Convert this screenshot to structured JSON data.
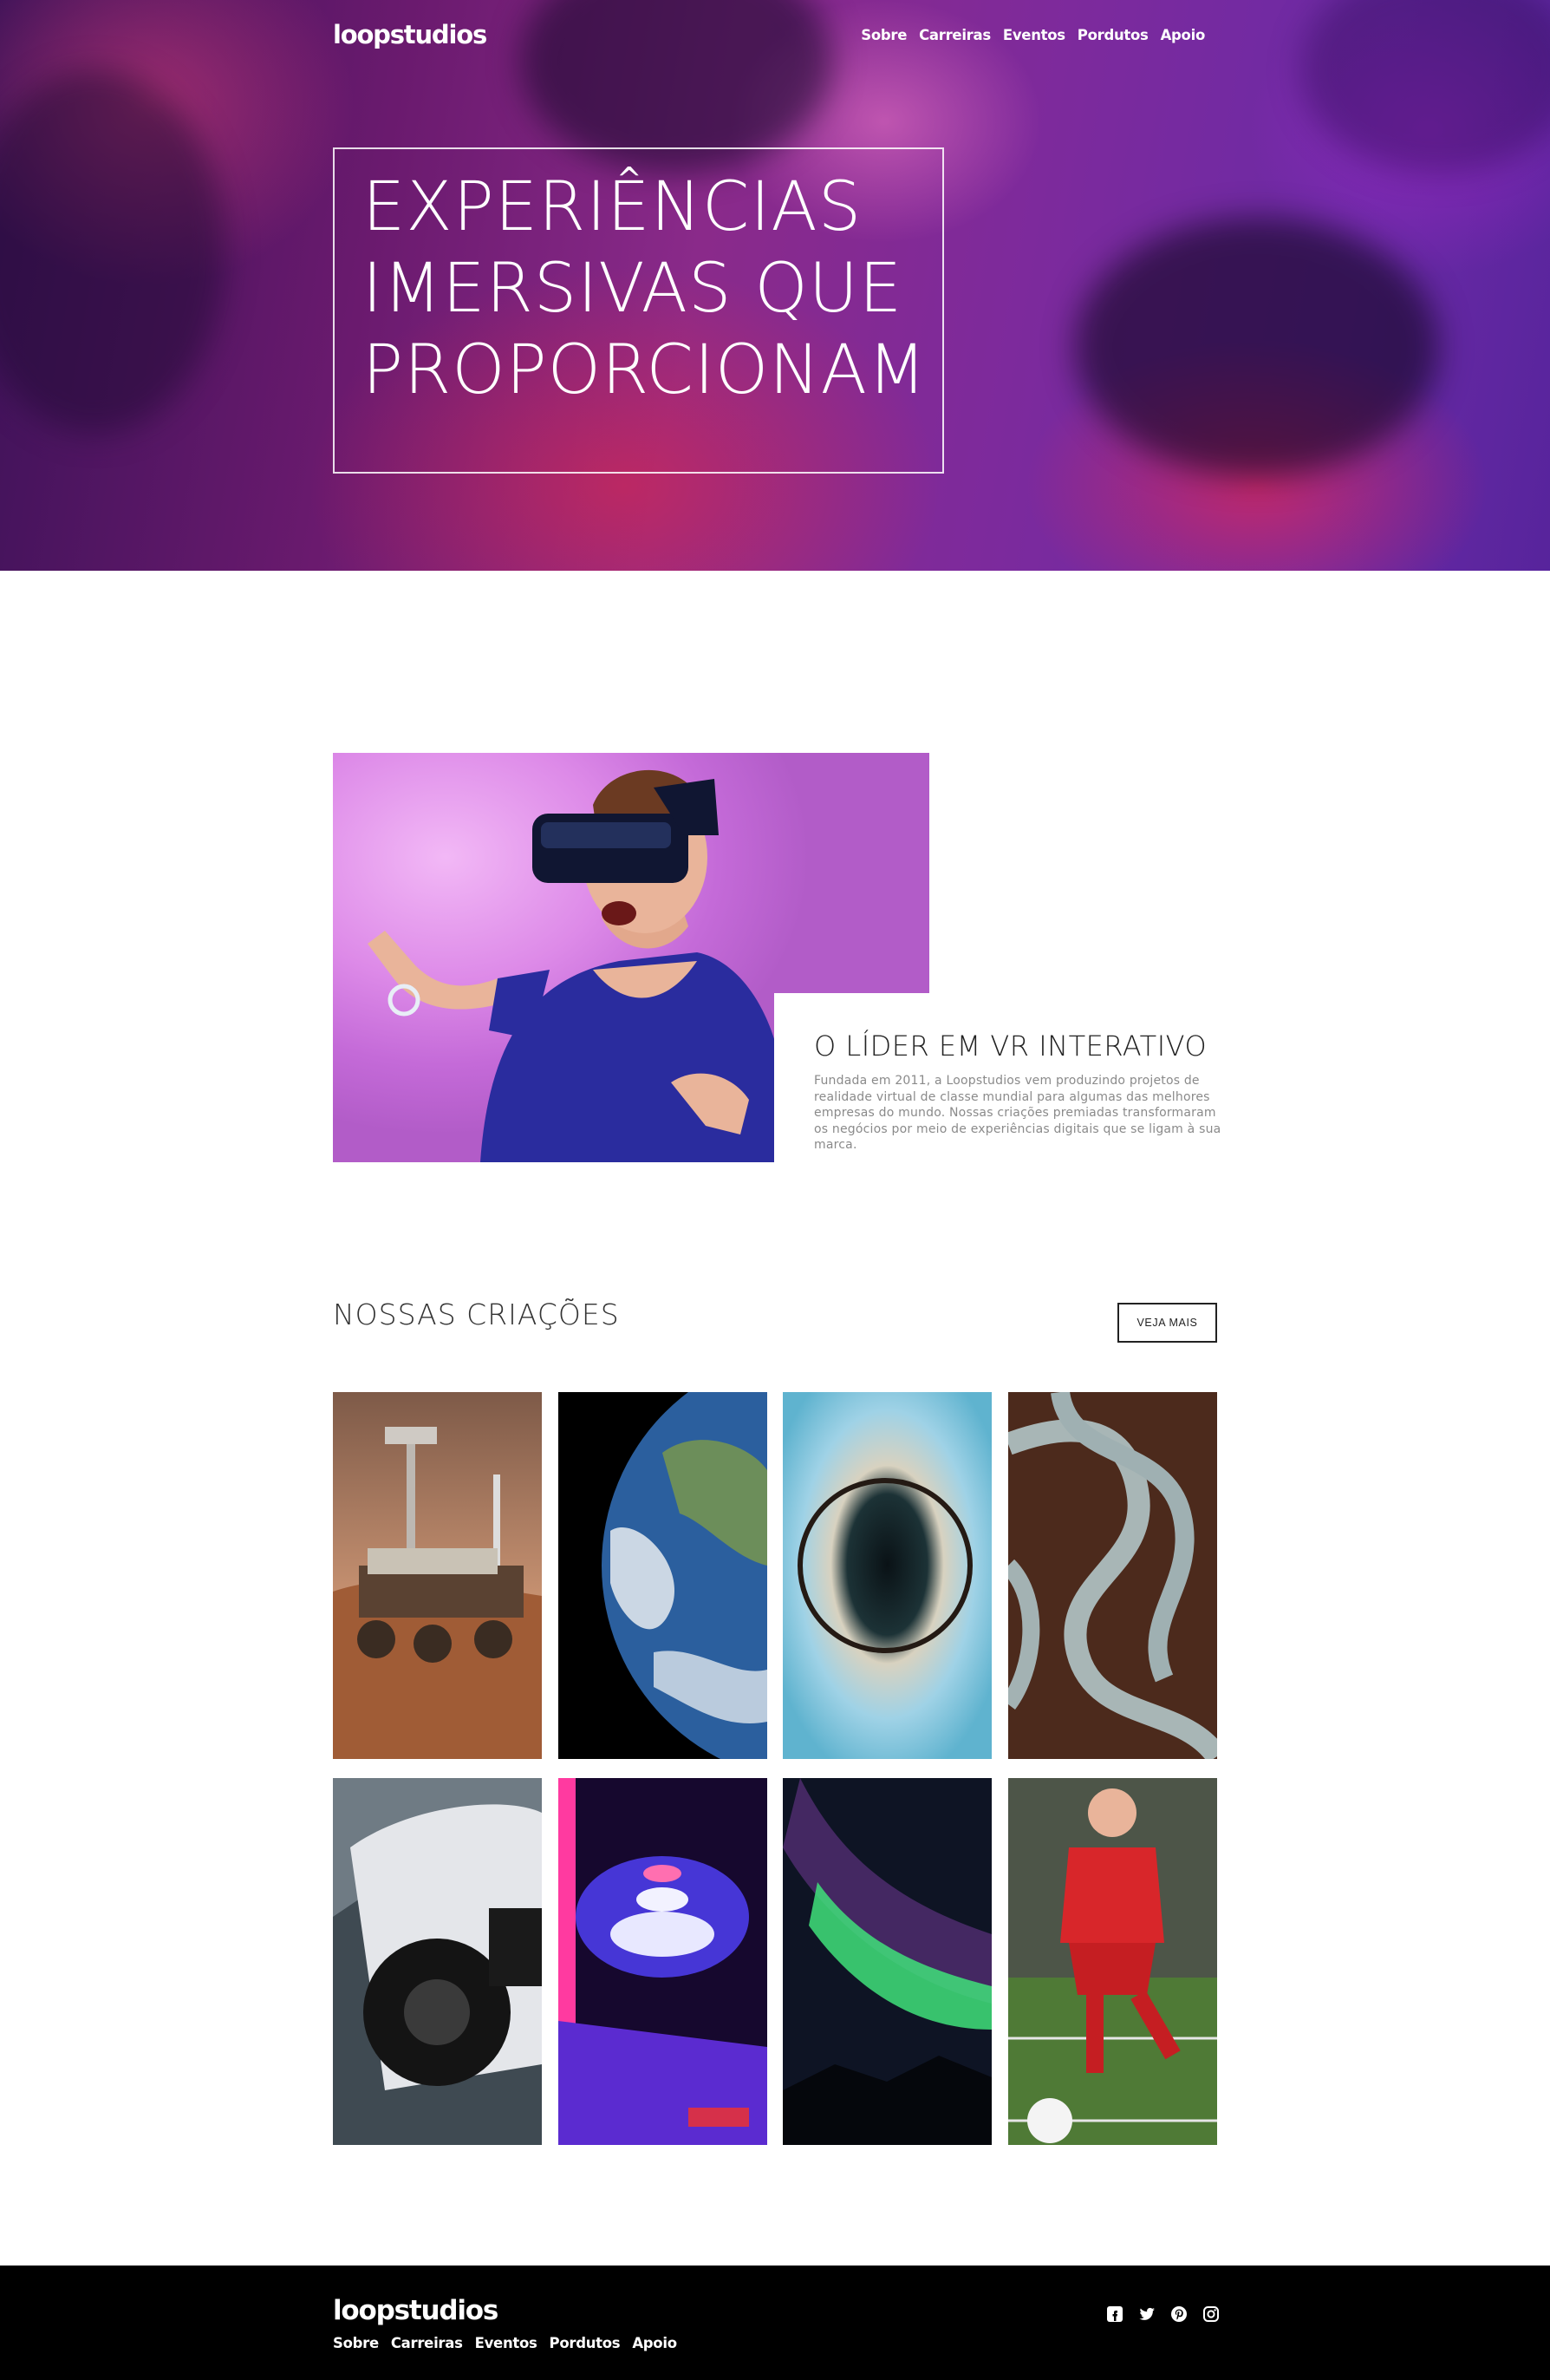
{
  "brand": {
    "logo": "loopstudios"
  },
  "nav": {
    "items": [
      "Sobre",
      "Carreiras",
      "Eventos",
      "Pordutos",
      "Apoio"
    ]
  },
  "hero": {
    "title": "EXPERIÊNCIAS IMERSIVAS QUE PROPORCIONAM"
  },
  "intro": {
    "heading": "O LÍDER EM VR INTERATIVO",
    "text": "Fundada em 2011, a Loopstudios vem produzindo projetos de realidade virtual de classe mundial para algumas das melhores empresas do mundo. Nossas criações premiadas transformaram os negócios por meio de experiências digitais que se ligam à sua marca."
  },
  "creations": {
    "title": "NOSSAS CRIAÇÕES",
    "see_more": "VEJA MAIS",
    "items": [
      {
        "subject": "mars-rover"
      },
      {
        "subject": "earth-from-space"
      },
      {
        "subject": "tiny-planet-panorama"
      },
      {
        "subject": "aerial-curving-roads"
      },
      {
        "subject": "race-car"
      },
      {
        "subject": "arcade-skee-ball"
      },
      {
        "subject": "northern-lights"
      },
      {
        "subject": "soccer-player"
      }
    ]
  },
  "footer": {
    "logo": "loopstudios",
    "links": [
      "Sobre",
      "Carreiras",
      "Eventos",
      "Pordutos",
      "Apoio"
    ],
    "socials": [
      "facebook-icon",
      "twitter-icon",
      "pinterest-icon",
      "instagram-icon"
    ]
  },
  "colors": {
    "footer_bg": "#000000",
    "hero_purple": "#7d2a9c",
    "hero_red": "#dc285a"
  }
}
